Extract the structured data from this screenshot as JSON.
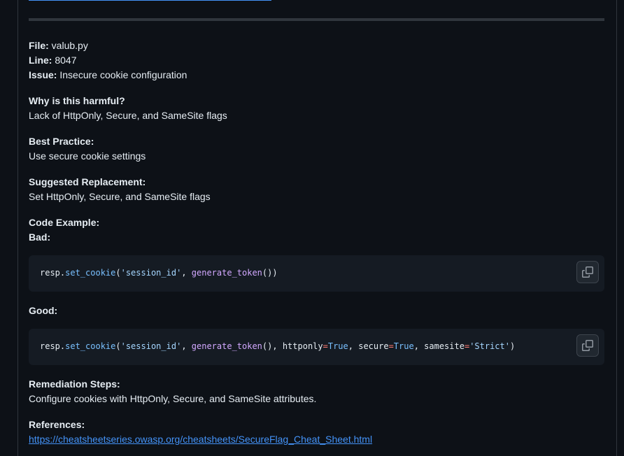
{
  "colors": {
    "background": "#0d1117",
    "code_background": "#151b23",
    "link": "#4493f8",
    "text": "#e6edf3"
  },
  "finding": {
    "file_label": "File:",
    "file_value": "valub.py",
    "line_label": "Line:",
    "line_value": "8047",
    "issue_label": "Issue:",
    "issue_value": "Insecure cookie configuration",
    "why_label": "Why is this harmful?",
    "why_value": "Lack of HttpOnly, Secure, and SameSite flags",
    "best_label": "Best Practice:",
    "best_value": "Use secure cookie settings",
    "replacement_label": "Suggested Replacement:",
    "replacement_value": "Set HttpOnly, Secure, and SameSite flags",
    "code_example_label": "Code Example:",
    "bad_label": "Bad:",
    "good_label": "Good:",
    "remediation_label": "Remediation Steps:",
    "remediation_value": "Configure cookies with HttpOnly, Secure, and SameSite attributes.",
    "references_label": "References:",
    "reference_url": "https://cheatsheetseries.owasp.org/cheatsheets/SecureFlag_Cheat_Sheet.html"
  },
  "bad_code": {
    "t1": "resp.",
    "t2": "set_cookie",
    "t3": "(",
    "t4": "'session_id'",
    "t5": ", ",
    "t6": "generate_token",
    "t7": "())"
  },
  "good_code": {
    "t1": "resp.",
    "t2": "set_cookie",
    "t3": "(",
    "t4": "'session_id'",
    "t5": ", ",
    "t6": "generate_token",
    "t7": "(), httponly",
    "t8": "=",
    "t9": "True",
    "t10": ", secure",
    "t11": "=",
    "t12": "True",
    "t13": ", samesite",
    "t14": "=",
    "t15": "'Strict'",
    "t16": ")"
  },
  "icons": {
    "copy": "copy-icon"
  }
}
